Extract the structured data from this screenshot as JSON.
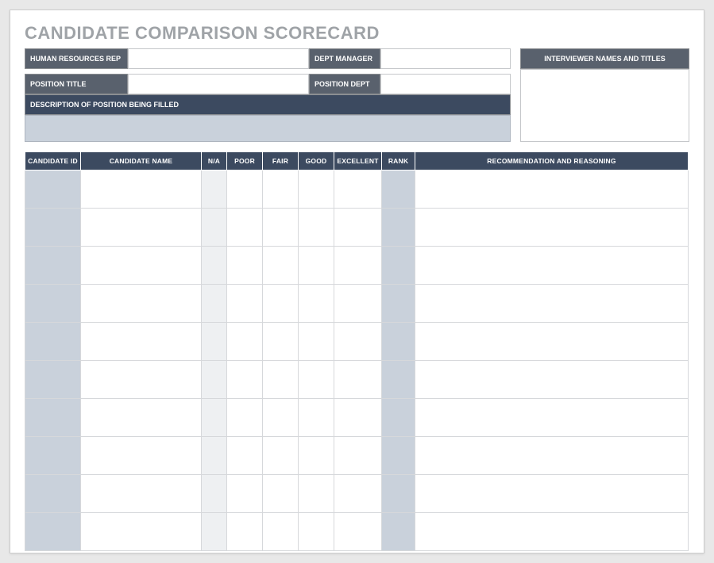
{
  "title": "CANDIDATE COMPARISON SCORECARD",
  "meta": {
    "hr_rep_label": "HUMAN RESOURCES REP",
    "hr_rep_value": "",
    "dept_mgr_label": "DEPT MANAGER",
    "dept_mgr_value": "",
    "pos_title_label": "POSITION TITLE",
    "pos_title_value": "",
    "pos_dept_label": "POSITION DEPT",
    "pos_dept_value": "",
    "desc_label": "DESCRIPTION OF POSITION BEING FILLED",
    "desc_value": "",
    "interviewer_label": "INTERVIEWER NAMES AND TITLES",
    "interviewer_value": ""
  },
  "table": {
    "headers": {
      "id": "CANDIDATE ID",
      "name": "CANDIDATE NAME",
      "na": "N/A",
      "poor": "POOR",
      "fair": "FAIR",
      "good": "GOOD",
      "excellent": "EXCELLENT",
      "rank": "RANK",
      "rec": "RECOMMENDATION AND REASONING"
    },
    "rows": [
      {
        "id": "",
        "name": "",
        "na": "",
        "poor": "",
        "fair": "",
        "good": "",
        "excellent": "",
        "rank": "",
        "rec": ""
      },
      {
        "id": "",
        "name": "",
        "na": "",
        "poor": "",
        "fair": "",
        "good": "",
        "excellent": "",
        "rank": "",
        "rec": ""
      },
      {
        "id": "",
        "name": "",
        "na": "",
        "poor": "",
        "fair": "",
        "good": "",
        "excellent": "",
        "rank": "",
        "rec": ""
      },
      {
        "id": "",
        "name": "",
        "na": "",
        "poor": "",
        "fair": "",
        "good": "",
        "excellent": "",
        "rank": "",
        "rec": ""
      },
      {
        "id": "",
        "name": "",
        "na": "",
        "poor": "",
        "fair": "",
        "good": "",
        "excellent": "",
        "rank": "",
        "rec": ""
      },
      {
        "id": "",
        "name": "",
        "na": "",
        "poor": "",
        "fair": "",
        "good": "",
        "excellent": "",
        "rank": "",
        "rec": ""
      },
      {
        "id": "",
        "name": "",
        "na": "",
        "poor": "",
        "fair": "",
        "good": "",
        "excellent": "",
        "rank": "",
        "rec": ""
      },
      {
        "id": "",
        "name": "",
        "na": "",
        "poor": "",
        "fair": "",
        "good": "",
        "excellent": "",
        "rank": "",
        "rec": ""
      },
      {
        "id": "",
        "name": "",
        "na": "",
        "poor": "",
        "fair": "",
        "good": "",
        "excellent": "",
        "rank": "",
        "rec": ""
      },
      {
        "id": "",
        "name": "",
        "na": "",
        "poor": "",
        "fair": "",
        "good": "",
        "excellent": "",
        "rank": "",
        "rec": ""
      }
    ]
  }
}
